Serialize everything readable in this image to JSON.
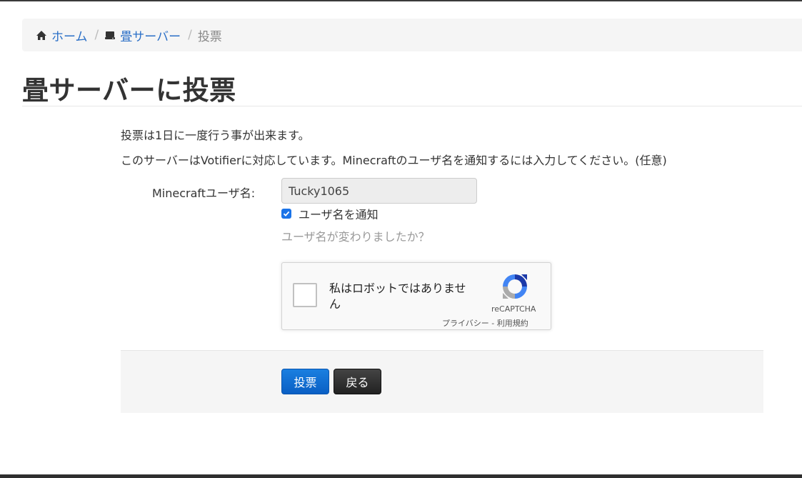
{
  "breadcrumb": {
    "home_icon": "home-icon",
    "home_label": "ホーム",
    "server_icon": "server-icon",
    "server_label": "畳サーバー",
    "current_label": "投票",
    "separator": "/"
  },
  "page": {
    "title": "畳サーバーに投票"
  },
  "info": {
    "line1": "投票は1日に一度行う事が出来ます。",
    "line2": "このサーバーはVotifierに対応しています。Minecraftのユーザ名を通知するには入力してください。(任意)"
  },
  "form": {
    "username_label": "Minecraftユーザ名:",
    "username_value": "Tucky1065",
    "notify_label": "ユーザ名を通知",
    "notify_checked": true,
    "changed_link": "ユーザ名が変わりましたか？"
  },
  "recaptcha": {
    "text": "私はロボットではありません",
    "brand": "reCAPTCHA",
    "links": "プライバシー - 利用規約"
  },
  "buttons": {
    "vote": "投票",
    "back": "戻る"
  },
  "colors": {
    "link": "#2a6fc7",
    "primary": "#0a66cc",
    "dark": "#222222"
  }
}
